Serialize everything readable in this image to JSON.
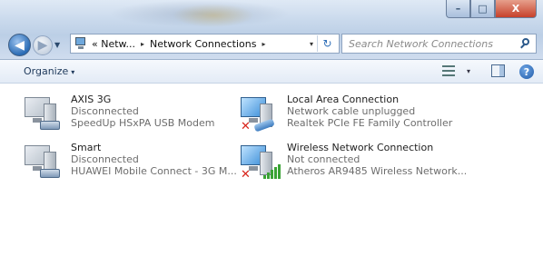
{
  "window": {
    "minimize_glyph": "–",
    "maximize_glyph": "□",
    "close_glyph": "X"
  },
  "address": {
    "crumbs": [
      "« Netw...",
      "Network Connections"
    ],
    "separator_glyph": "▸",
    "dropdown_glyph": "▾",
    "refresh_glyph": "↻"
  },
  "search": {
    "placeholder": "Search Network Connections"
  },
  "toolbar": {
    "organize_label": "Organize",
    "organize_arrow": "▾",
    "views_arrow": "▾",
    "help_label": "?"
  },
  "connections": [
    {
      "name": "AXIS 3G",
      "status": "Disconnected",
      "device": "SpeedUp HSxPA USB Modem",
      "icon": "modem-icon"
    },
    {
      "name": "Local Area Connection",
      "status": "Network cable unplugged",
      "device": "Realtek PCIe FE Family Controller",
      "icon": "ethernet-icon"
    },
    {
      "name": "Smart",
      "status": "Disconnected",
      "device": "HUAWEI Mobile Connect - 3G M...",
      "icon": "modem-icon"
    },
    {
      "name": "Wireless Network Connection",
      "status": "Not connected",
      "device": "Atheros AR9485 Wireless Network...",
      "icon": "wireless-icon"
    }
  ],
  "status_mark": "✕",
  "colors": {
    "accent": "#2b6cb5",
    "error": "#d8241b",
    "signal": "#3aa335"
  }
}
